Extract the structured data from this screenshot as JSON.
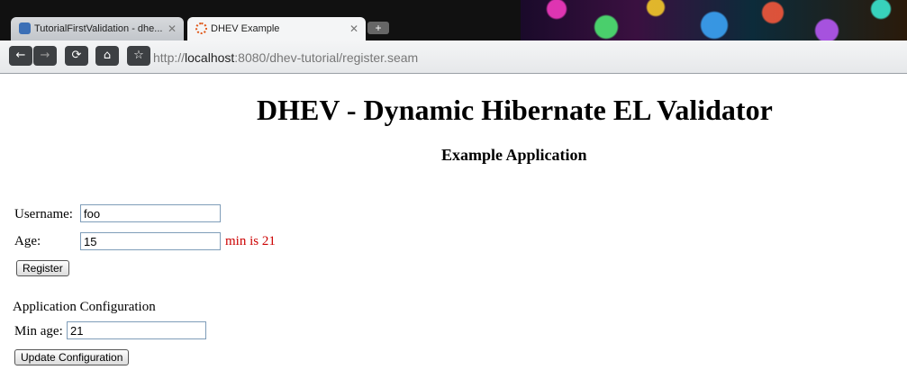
{
  "browser": {
    "tabs": [
      {
        "title": "TutorialFirstValidation - dhe...",
        "active": false
      },
      {
        "title": "DHEV Example",
        "active": true
      }
    ],
    "new_tab": "+",
    "url_prefix": "http://",
    "url_host": "localhost",
    "url_rest": ":8080/dhev-tutorial/register.seam"
  },
  "page": {
    "title": "DHEV - Dynamic Hibernate EL Validator",
    "subtitle": "Example Application",
    "form": {
      "username_label": "Username:",
      "username_value": "foo",
      "age_label": "Age:",
      "age_value": "15",
      "age_error": "min is 21",
      "register_label": "Register"
    },
    "config": {
      "heading": "Application Configuration",
      "min_age_label": "Min age:",
      "min_age_value": "21",
      "update_label": "Update Configuration"
    }
  },
  "colors": {
    "error": "#cc0000",
    "input_border": "#7f9db9"
  }
}
